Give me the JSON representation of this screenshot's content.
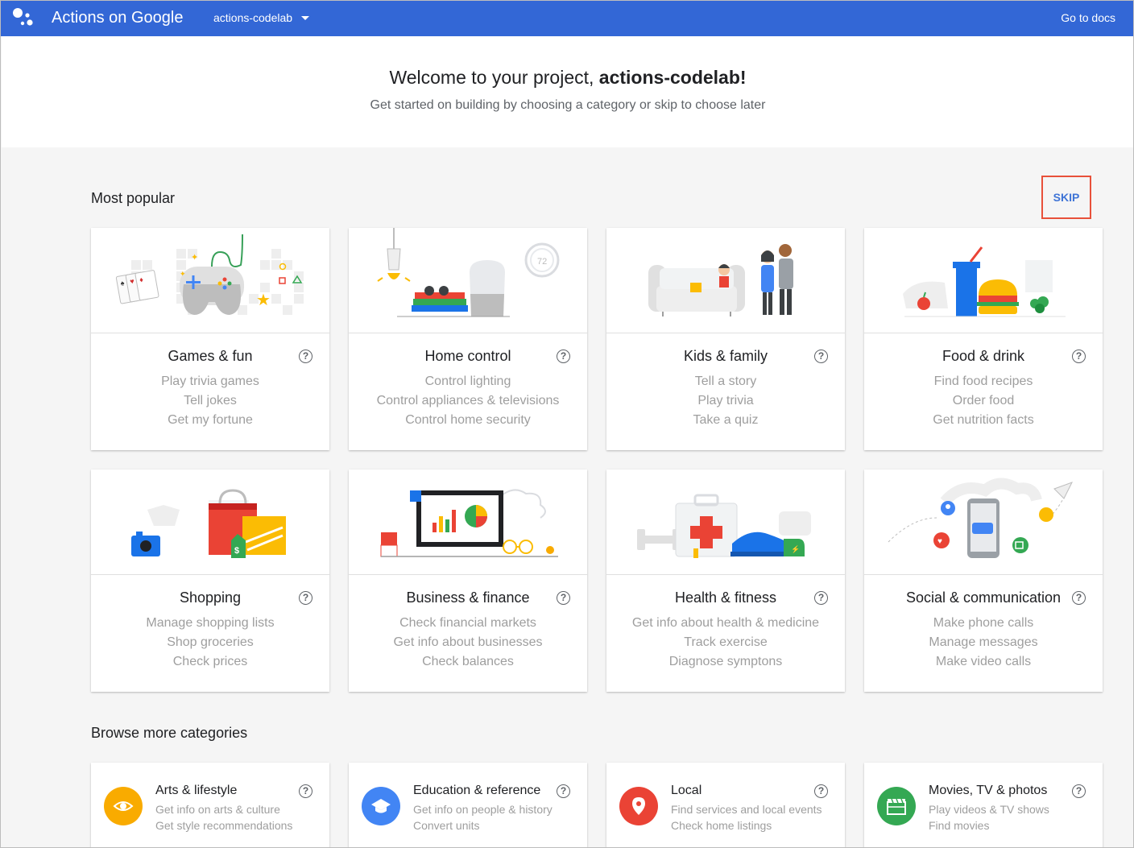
{
  "header": {
    "brand": "Actions on Google",
    "project": "actions-codelab",
    "docs_link": "Go to docs",
    "bar_color": "#3367d6"
  },
  "welcome": {
    "title_prefix": "Welcome to your project, ",
    "title_project": "actions-codelab!",
    "subtitle": "Get started on building by choosing a category or skip to choose later"
  },
  "most_popular": {
    "heading": "Most popular",
    "skip_label": "SKIP",
    "help_glyph": "?",
    "cards": [
      {
        "title": "Games & fun",
        "lines": [
          "Play trivia games",
          "Tell jokes",
          "Get my fortune"
        ],
        "illustration": "games-illustration"
      },
      {
        "title": "Home control",
        "lines": [
          "Control lighting",
          "Control appliances & televisions",
          "Control home security"
        ],
        "illustration": "home-control-illustration"
      },
      {
        "title": "Kids & family",
        "lines": [
          "Tell a story",
          "Play trivia",
          "Take a quiz"
        ],
        "illustration": "kids-family-illustration"
      },
      {
        "title": "Food & drink",
        "lines": [
          "Find food recipes",
          "Order food",
          "Get nutrition facts"
        ],
        "illustration": "food-drink-illustration"
      },
      {
        "title": "Shopping",
        "lines": [
          "Manage shopping lists",
          "Shop groceries",
          "Check prices"
        ],
        "illustration": "shopping-illustration"
      },
      {
        "title": "Business & finance",
        "lines": [
          "Check financial markets",
          "Get info about businesses",
          "Check balances"
        ],
        "illustration": "business-finance-illustration"
      },
      {
        "title": "Health & fitness",
        "lines": [
          "Get info about health & medicine",
          "Track exercise",
          "Diagnose symptons"
        ],
        "illustration": "health-fitness-illustration"
      },
      {
        "title": "Social & communication",
        "lines": [
          "Make phone calls",
          "Manage messages",
          "Make video calls"
        ],
        "illustration": "social-communication-illustration"
      }
    ]
  },
  "browse_more": {
    "heading": "Browse more categories",
    "items": [
      {
        "title": "Arts & lifestyle",
        "lines": [
          "Get info on arts & culture",
          "Get style recommendations"
        ],
        "icon": "eye-icon",
        "color": "#f9ab00"
      },
      {
        "title": "Education & reference",
        "lines": [
          "Get info on people & history",
          "Convert units"
        ],
        "icon": "school-icon",
        "color": "#4285f4"
      },
      {
        "title": "Local",
        "lines": [
          "Find services and local events",
          "Check home listings"
        ],
        "icon": "map-pin-icon",
        "color": "#ea4335"
      },
      {
        "title": "Movies, TV & photos",
        "lines": [
          "Play videos & TV shows",
          "Find movies"
        ],
        "icon": "clapperboard-icon",
        "color": "#34a853"
      }
    ]
  }
}
